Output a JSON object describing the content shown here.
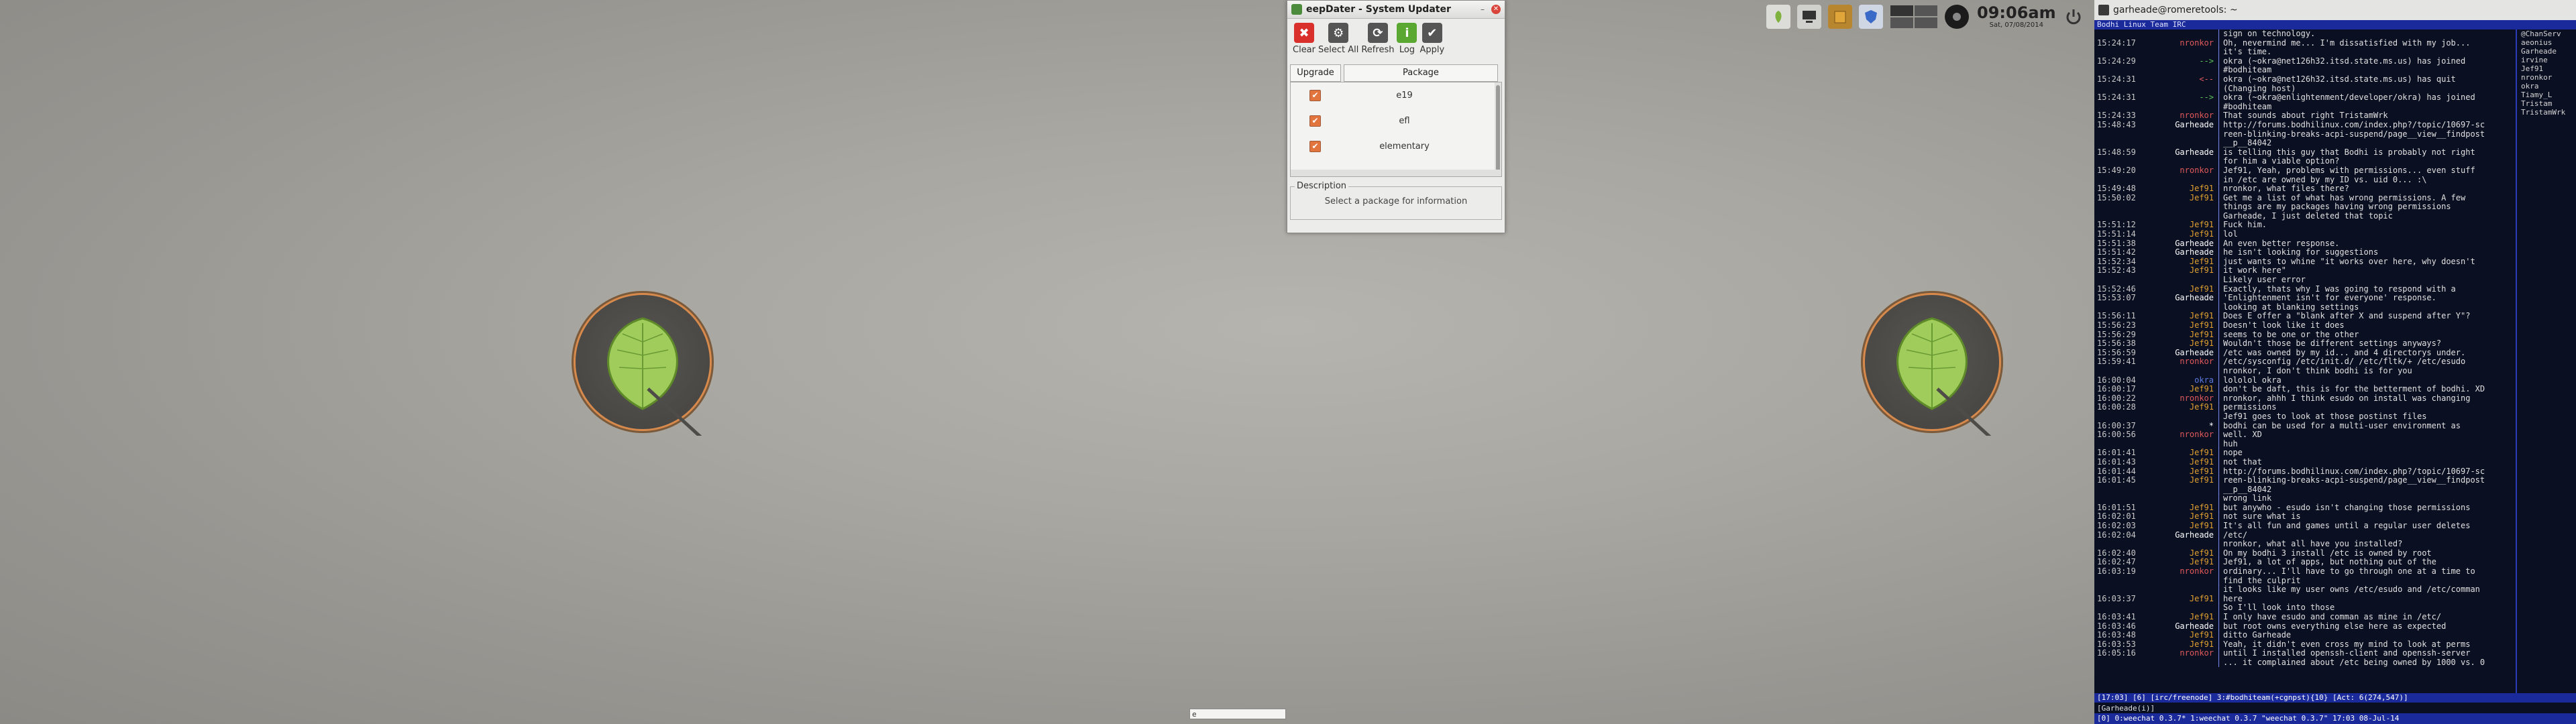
{
  "updater": {
    "title": "eepDater - System Updater",
    "toolbar": [
      {
        "label": "Clear",
        "icon": "clear-icon",
        "color": "#d9302b",
        "glyph": "✖"
      },
      {
        "label": "Select All",
        "icon": "gear-icon",
        "color": "#555555",
        "glyph": "⚙"
      },
      {
        "label": "Refresh",
        "icon": "refresh-icon",
        "color": "#555555",
        "glyph": "⟳"
      },
      {
        "label": "Log",
        "icon": "info-icon",
        "color": "#5aa832",
        "glyph": "i"
      },
      {
        "label": "Apply",
        "icon": "check-icon",
        "color": "#555555",
        "glyph": "✔"
      }
    ],
    "tabs": [
      "Upgrade",
      "Package"
    ],
    "packages": [
      {
        "name": "e19",
        "checked": true
      },
      {
        "name": "efl",
        "checked": true
      },
      {
        "name": "elementary",
        "checked": true
      }
    ],
    "description_legend": "Description",
    "description_hint": "Select a package for information"
  },
  "tray": {
    "time": "09:06am",
    "date": "Sat, 07/08/2014",
    "icons": [
      "leaf-icon",
      "computer-icon",
      "package-icon",
      "shield-icon",
      "workspace-pager-icon",
      "volume-icon",
      "power-icon"
    ]
  },
  "center_entry": "e",
  "terminal": {
    "title": "garheade@romeretools: ~",
    "topic": "Bodhi Linux Team IRC",
    "lines": [
      {
        "ts": "",
        "nick": "",
        "nick_color": "#d7d7d7",
        "msg": "sign on technology."
      },
      {
        "ts": "15:24:17",
        "nick": "nronkor",
        "nick_color": "#e05a5a",
        "msg": "Oh, nevermind me... I'm dissatisfied with my job..."
      },
      {
        "ts": "",
        "nick": "",
        "nick_color": "#d7d7d7",
        "msg": "it's time."
      },
      {
        "ts": "15:24:29",
        "nick": "-->",
        "nick_color": "#5ac85a",
        "msg": "okra (~okra@net126h32.itsd.state.ms.us) has joined"
      },
      {
        "ts": "",
        "nick": "",
        "nick_color": "#d7d7d7",
        "msg": "#bodhiteam"
      },
      {
        "ts": "15:24:31",
        "nick": "<--",
        "nick_color": "#e05a5a",
        "msg": "okra (~okra@net126h32.itsd.state.ms.us) has quit"
      },
      {
        "ts": "",
        "nick": "",
        "nick_color": "#d7d7d7",
        "msg": "(Changing host)"
      },
      {
        "ts": "15:24:31",
        "nick": "-->",
        "nick_color": "#5ac85a",
        "msg": "okra (~okra@enlightenment/developer/okra) has joined"
      },
      {
        "ts": "",
        "nick": "",
        "nick_color": "#d7d7d7",
        "msg": "#bodhiteam"
      },
      {
        "ts": "15:24:33",
        "nick": "nronkor",
        "nick_color": "#e05a5a",
        "msg": "That sounds about right TristamWrk"
      },
      {
        "ts": "15:48:43",
        "nick": "Garheade",
        "nick_color": "#ffffff",
        "msg": "http://forums.bodhilinux.com/index.php?/topic/10697-sc"
      },
      {
        "ts": "",
        "nick": "",
        "nick_color": "#d7d7d7",
        "msg": "reen-blinking-breaks-acpi-suspend/page__view__findpost"
      },
      {
        "ts": "",
        "nick": "",
        "nick_color": "#d7d7d7",
        "msg": "__p__84042"
      },
      {
        "ts": "15:48:59",
        "nick": "Garheade",
        "nick_color": "#ffffff",
        "msg": "is telling this guy that Bodhi is probably not right"
      },
      {
        "ts": "",
        "nick": "",
        "nick_color": "#d7d7d7",
        "msg": "for him a viable option?"
      },
      {
        "ts": "15:49:20",
        "nick": "nronkor",
        "nick_color": "#e05a5a",
        "msg": "Jef91, Yeah, problems with permissions... even stuff"
      },
      {
        "ts": "",
        "nick": "",
        "nick_color": "#d7d7d7",
        "msg": "in /etc are owned by my ID vs. uid 0... :\\"
      },
      {
        "ts": "15:49:48",
        "nick": "Jef91",
        "nick_color": "#e0a030",
        "msg": "nronkor, what files there?"
      },
      {
        "ts": "15:50:02",
        "nick": "Jef91",
        "nick_color": "#e0a030",
        "msg": "Get me a list of what has wrong permissions. A few"
      },
      {
        "ts": "",
        "nick": "",
        "nick_color": "#d7d7d7",
        "msg": "things are my packages having wrong permissions"
      },
      {
        "ts": "",
        "nick": "",
        "nick_color": "#d7d7d7",
        "msg": "Garheade, I just deleted that topic"
      },
      {
        "ts": "15:51:12",
        "nick": "Jef91",
        "nick_color": "#e0a030",
        "msg": "Fuck him."
      },
      {
        "ts": "15:51:14",
        "nick": "Jef91",
        "nick_color": "#e0a030",
        "msg": "lol"
      },
      {
        "ts": "15:51:38",
        "nick": "Garheade",
        "nick_color": "#ffffff",
        "msg": "An even better response."
      },
      {
        "ts": "15:51:42",
        "nick": "Garheade",
        "nick_color": "#ffffff",
        "msg": "he isn't looking for suggestions"
      },
      {
        "ts": "15:52:34",
        "nick": "Jef91",
        "nick_color": "#e0a030",
        "msg": "just wants to whine \"it works over here, why doesn't"
      },
      {
        "ts": "15:52:43",
        "nick": "Jef91",
        "nick_color": "#e0a030",
        "msg": "it work here\""
      },
      {
        "ts": "",
        "nick": "",
        "nick_color": "#d7d7d7",
        "msg": "Likely user error"
      },
      {
        "ts": "15:52:46",
        "nick": "Jef91",
        "nick_color": "#e0a030",
        "msg": "Exactly, thats why I was going to respond with a"
      },
      {
        "ts": "15:53:07",
        "nick": "Garheade",
        "nick_color": "#ffffff",
        "msg": "'Enlightenment isn't for everyone' response."
      },
      {
        "ts": "",
        "nick": "",
        "nick_color": "#d7d7d7",
        "msg": "looking at blanking settings"
      },
      {
        "ts": "15:56:11",
        "nick": "Jef91",
        "nick_color": "#e0a030",
        "msg": "Does E offer a \"blank after X and suspend after Y\"?"
      },
      {
        "ts": "15:56:23",
        "nick": "Jef91",
        "nick_color": "#e0a030",
        "msg": "Doesn't look like it does"
      },
      {
        "ts": "15:56:29",
        "nick": "Jef91",
        "nick_color": "#e0a030",
        "msg": "seems to be one or the other"
      },
      {
        "ts": "15:56:38",
        "nick": "Jef91",
        "nick_color": "#e0a030",
        "msg": "Wouldn't those be different settings anyways?"
      },
      {
        "ts": "15:56:59",
        "nick": "Garheade",
        "nick_color": "#ffffff",
        "msg": "/etc was owned by my id... and 4 directorys under."
      },
      {
        "ts": "15:59:41",
        "nick": "nronkor",
        "nick_color": "#e05a5a",
        "msg": "/etc/sysconfig /etc/init.d/ /etc/fltk/+ /etc/esudo"
      },
      {
        "ts": "",
        "nick": "",
        "nick_color": "#d7d7d7",
        "msg": "nronkor, I don't think bodhi is for you"
      },
      {
        "ts": "16:00:04",
        "nick": "okra",
        "nick_color": "#5a7ae0",
        "msg": "lololol okra"
      },
      {
        "ts": "16:00:17",
        "nick": "Jef91",
        "nick_color": "#e0a030",
        "msg": "don't be daft, this is for the betterment of bodhi. XD"
      },
      {
        "ts": "16:00:22",
        "nick": "nronkor",
        "nick_color": "#e05a5a",
        "msg": "nronkor, ahhh I think esudo on install was changing"
      },
      {
        "ts": "16:00:28",
        "nick": "Jef91",
        "nick_color": "#e0a030",
        "msg": "permissions"
      },
      {
        "ts": "",
        "nick": "",
        "nick_color": "#d7d7d7",
        "msg": "Jef91 goes to look at those postinst files"
      },
      {
        "ts": "16:00:37",
        "nick": "*",
        "nick_color": "#ffffff",
        "msg": "bodhi can be used for a multi-user environment as"
      },
      {
        "ts": "16:00:56",
        "nick": "nronkor",
        "nick_color": "#e05a5a",
        "msg": "well. XD"
      },
      {
        "ts": "",
        "nick": "",
        "nick_color": "#d7d7d7",
        "msg": "huh"
      },
      {
        "ts": "16:01:41",
        "nick": "Jef91",
        "nick_color": "#e0a030",
        "msg": "nope"
      },
      {
        "ts": "16:01:43",
        "nick": "Jef91",
        "nick_color": "#e0a030",
        "msg": "not that"
      },
      {
        "ts": "16:01:44",
        "nick": "Jef91",
        "nick_color": "#e0a030",
        "msg": "http://forums.bodhilinux.com/index.php?/topic/10697-sc"
      },
      {
        "ts": "16:01:45",
        "nick": "Jef91",
        "nick_color": "#e0a030",
        "msg": "reen-blinking-breaks-acpi-suspend/page__view__findpost"
      },
      {
        "ts": "",
        "nick": "",
        "nick_color": "#d7d7d7",
        "msg": "__p__84042"
      },
      {
        "ts": "",
        "nick": "",
        "nick_color": "#d7d7d7",
        "msg": "wrong link"
      },
      {
        "ts": "16:01:51",
        "nick": "Jef91",
        "nick_color": "#e0a030",
        "msg": "but anywho - esudo isn't changing those permissions"
      },
      {
        "ts": "16:02:01",
        "nick": "Jef91",
        "nick_color": "#e0a030",
        "msg": "not sure what is"
      },
      {
        "ts": "16:02:03",
        "nick": "Jef91",
        "nick_color": "#e0a030",
        "msg": "It's all fun and games until a regular user deletes"
      },
      {
        "ts": "16:02:04",
        "nick": "Garheade",
        "nick_color": "#ffffff",
        "msg": "/etc/"
      },
      {
        "ts": "",
        "nick": "",
        "nick_color": "#d7d7d7",
        "msg": "nronkor, what all have you installed?"
      },
      {
        "ts": "16:02:40",
        "nick": "Jef91",
        "nick_color": "#e0a030",
        "msg": "On my bodhi 3 install /etc is owned by root"
      },
      {
        "ts": "16:02:47",
        "nick": "Jef91",
        "nick_color": "#e0a030",
        "msg": "Jef91, a lot of apps, but nothing out of the"
      },
      {
        "ts": "16:03:19",
        "nick": "nronkor",
        "nick_color": "#e05a5a",
        "msg": "ordinary... I'll have to go through one at a time to"
      },
      {
        "ts": "",
        "nick": "",
        "nick_color": "#d7d7d7",
        "msg": "find the culprit"
      },
      {
        "ts": "",
        "nick": "",
        "nick_color": "#d7d7d7",
        "msg": "it looks like my user owns /etc/esudo and /etc/comman"
      },
      {
        "ts": "16:03:37",
        "nick": "Jef91",
        "nick_color": "#e0a030",
        "msg": "here"
      },
      {
        "ts": "",
        "nick": "",
        "nick_color": "#d7d7d7",
        "msg": "So I'll look into those"
      },
      {
        "ts": "16:03:41",
        "nick": "Jef91",
        "nick_color": "#e0a030",
        "msg": "I only have esudo and comman as mine in /etc/"
      },
      {
        "ts": "16:03:46",
        "nick": "Garheade",
        "nick_color": "#ffffff",
        "msg": "but root owns everything else here as expected"
      },
      {
        "ts": "16:03:48",
        "nick": "Jef91",
        "nick_color": "#e0a030",
        "msg": "ditto Garheade"
      },
      {
        "ts": "16:03:53",
        "nick": "Jef91",
        "nick_color": "#e0a030",
        "msg": "Yeah, it didn't even cross my mind to look at perms"
      },
      {
        "ts": "16:05:16",
        "nick": "nronkor",
        "nick_color": "#e05a5a",
        "msg": "until I installed openssh-client and openssh-server"
      },
      {
        "ts": "",
        "nick": "",
        "nick_color": "#d7d7d7",
        "msg": "... it complained about /etc being owned by 1000 vs. 0"
      }
    ],
    "nicks": [
      "@ChanServ",
      "aeonius",
      "Garheade",
      "irvine",
      "Jef91",
      "nronkor",
      "okra",
      "Tiamy_L",
      "Tristam",
      "TristamWrk"
    ],
    "status_bar": "[17:03] [6] [irc/freenode] 3:#bodhiteam(+cgnpst){10} [Act: 6(274,547)]",
    "input_line": "[Garheade(i)]",
    "status_bar_bottom": "[0] 0:weechat 0.3.7*  1:weechat 0.3.7  \"weechat 0.3.7\" 17:03 08-Jul-14"
  }
}
